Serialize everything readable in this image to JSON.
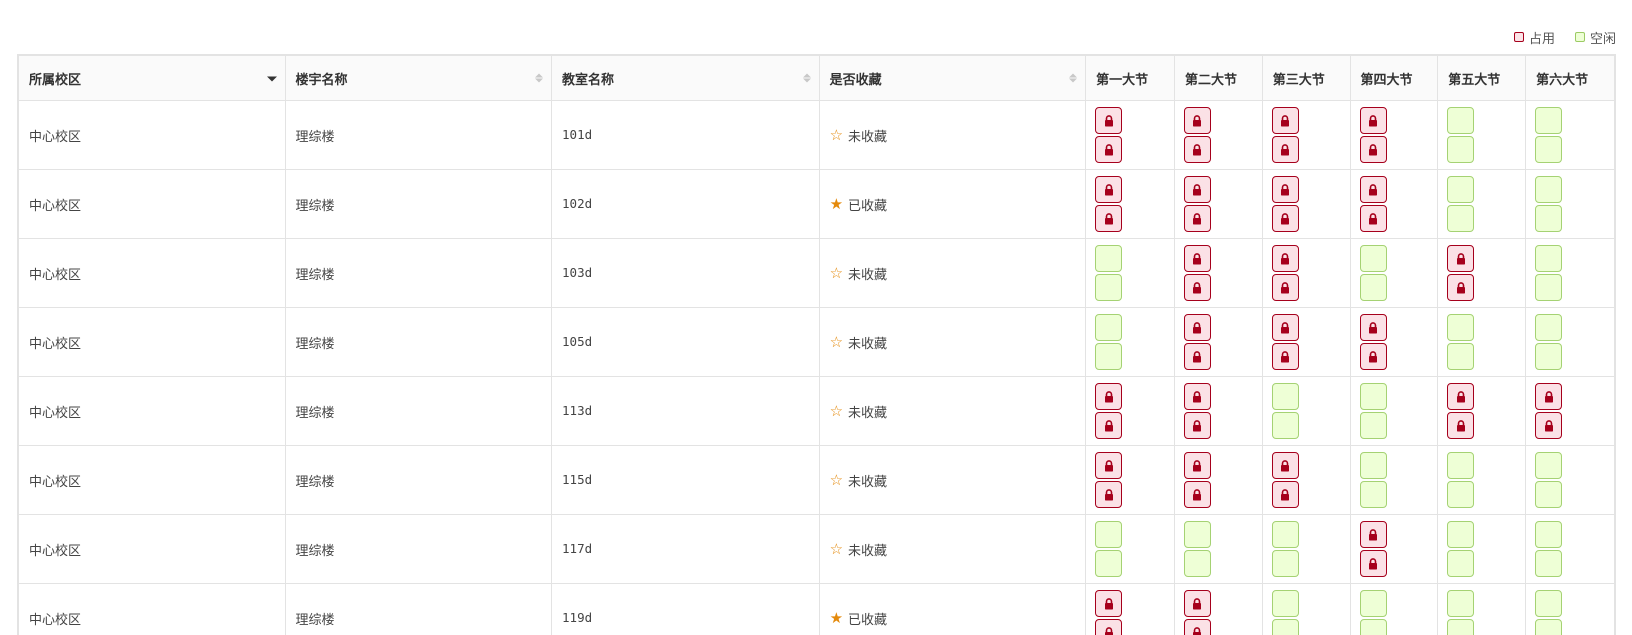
{
  "legend": {
    "occupied_label": "占用",
    "free_label": "空闲"
  },
  "columns": {
    "campus": "所属校区",
    "building": "楼宇名称",
    "room": "教室名称",
    "favorite": "是否收藏",
    "periods": [
      "第一大节",
      "第二大节",
      "第三大节",
      "第四大节",
      "第五大节",
      "第六大节"
    ]
  },
  "favorite_labels": {
    "yes": "已收藏",
    "no": "未收藏"
  },
  "colors": {
    "occupied_border": "#a6001c",
    "occupied_fill": "#fbe1e6",
    "free_border": "#a5d273",
    "free_fill": "#eeffd6",
    "star": "#e48a0c"
  },
  "rows": [
    {
      "campus": "中心校区",
      "building": "理综楼",
      "room": "101d",
      "favorite": false,
      "slots": [
        [
          1,
          1
        ],
        [
          1,
          1
        ],
        [
          1,
          1
        ],
        [
          1,
          1
        ],
        [
          0,
          0
        ],
        [
          0,
          0
        ]
      ]
    },
    {
      "campus": "中心校区",
      "building": "理综楼",
      "room": "102d",
      "favorite": true,
      "slots": [
        [
          1,
          1
        ],
        [
          1,
          1
        ],
        [
          1,
          1
        ],
        [
          1,
          1
        ],
        [
          0,
          0
        ],
        [
          0,
          0
        ]
      ]
    },
    {
      "campus": "中心校区",
      "building": "理综楼",
      "room": "103d",
      "favorite": false,
      "slots": [
        [
          0,
          0
        ],
        [
          1,
          1
        ],
        [
          1,
          1
        ],
        [
          0,
          0
        ],
        [
          1,
          1
        ],
        [
          0,
          0
        ]
      ]
    },
    {
      "campus": "中心校区",
      "building": "理综楼",
      "room": "105d",
      "favorite": false,
      "slots": [
        [
          0,
          0
        ],
        [
          1,
          1
        ],
        [
          1,
          1
        ],
        [
          1,
          1
        ],
        [
          0,
          0
        ],
        [
          0,
          0
        ]
      ]
    },
    {
      "campus": "中心校区",
      "building": "理综楼",
      "room": "113d",
      "favorite": false,
      "slots": [
        [
          1,
          1
        ],
        [
          1,
          1
        ],
        [
          0,
          0
        ],
        [
          0,
          0
        ],
        [
          1,
          1
        ],
        [
          1,
          1
        ]
      ]
    },
    {
      "campus": "中心校区",
      "building": "理综楼",
      "room": "115d",
      "favorite": false,
      "slots": [
        [
          1,
          1
        ],
        [
          1,
          1
        ],
        [
          1,
          1
        ],
        [
          0,
          0
        ],
        [
          0,
          0
        ],
        [
          0,
          0
        ]
      ]
    },
    {
      "campus": "中心校区",
      "building": "理综楼",
      "room": "117d",
      "favorite": false,
      "slots": [
        [
          0,
          0
        ],
        [
          0,
          0
        ],
        [
          0,
          0
        ],
        [
          1,
          1
        ],
        [
          0,
          0
        ],
        [
          0,
          0
        ]
      ]
    },
    {
      "campus": "中心校区",
      "building": "理综楼",
      "room": "119d",
      "favorite": true,
      "slots": [
        [
          1,
          1
        ],
        [
          1,
          1
        ],
        [
          0,
          0
        ],
        [
          0,
          0
        ],
        [
          0,
          0
        ],
        [
          0,
          0
        ]
      ]
    }
  ]
}
